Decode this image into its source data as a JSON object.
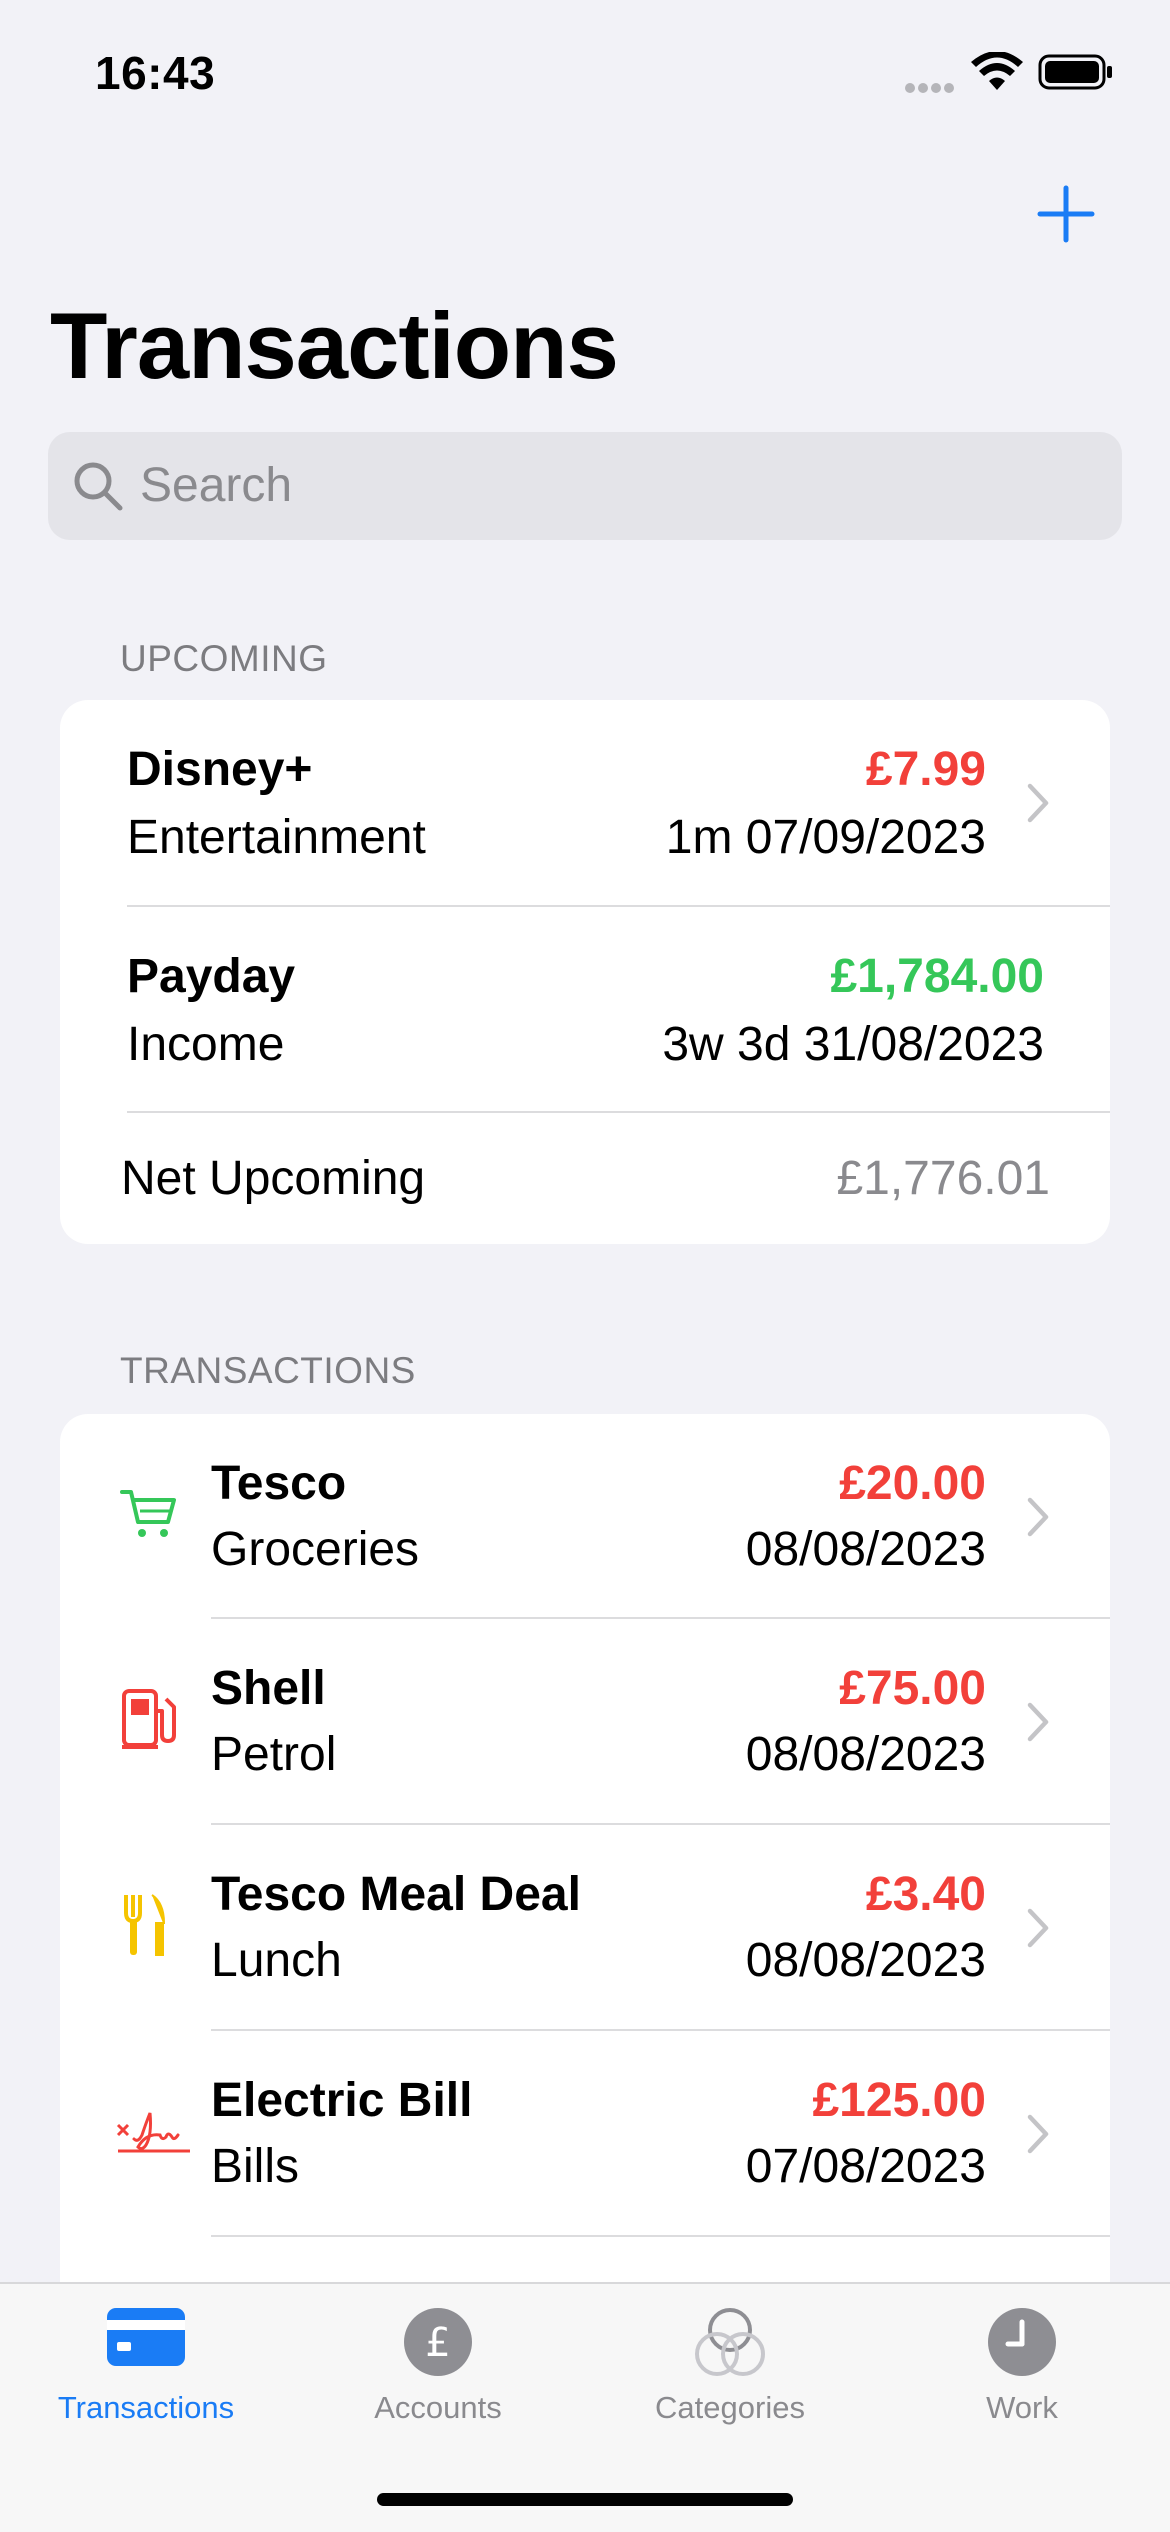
{
  "status_bar": {
    "time": "16:43"
  },
  "header": {
    "title": "Transactions",
    "add_icon": "plus-icon"
  },
  "search": {
    "placeholder": "Search"
  },
  "upcoming": {
    "header": "UPCOMING",
    "items": [
      {
        "name": "Disney+",
        "category": "Entertainment",
        "amount": "£7.99",
        "amount_color": "#f2403a",
        "due": "1m  07/09/2023"
      },
      {
        "name": "Payday",
        "category": "Income",
        "amount": "£1,784.00",
        "amount_color": "#35c759",
        "due": "3w 3d  31/08/2023"
      }
    ],
    "net_label": "Net Upcoming",
    "net_value": "£1,776.01"
  },
  "transactions": {
    "header": "TRANSACTIONS",
    "items": [
      {
        "icon": "cart-icon",
        "name": "Tesco",
        "category": "Groceries",
        "amount": "£20.00",
        "date": "08/08/2023"
      },
      {
        "icon": "fuel-pump-icon",
        "name": "Shell",
        "category": "Petrol",
        "amount": "£75.00",
        "date": "08/08/2023"
      },
      {
        "icon": "fork-knife-icon",
        "name": "Tesco Meal Deal",
        "category": "Lunch",
        "amount": "£3.40",
        "date": "08/08/2023"
      },
      {
        "icon": "signature-icon",
        "name": "Electric Bill",
        "category": "Bills",
        "amount": "£125.00",
        "date": "07/08/2023"
      }
    ]
  },
  "tab_bar": {
    "tabs": [
      {
        "label": "Transactions",
        "icon": "credit-card-icon",
        "active": true
      },
      {
        "label": "Accounts",
        "icon": "pound-circle-icon",
        "active": false
      },
      {
        "label": "Categories",
        "icon": "circles-icon",
        "active": false
      },
      {
        "label": "Work",
        "icon": "clock-icon",
        "active": false
      }
    ]
  },
  "colors": {
    "accent": "#1a7cf5",
    "expense": "#f2403a",
    "income": "#35c759"
  }
}
